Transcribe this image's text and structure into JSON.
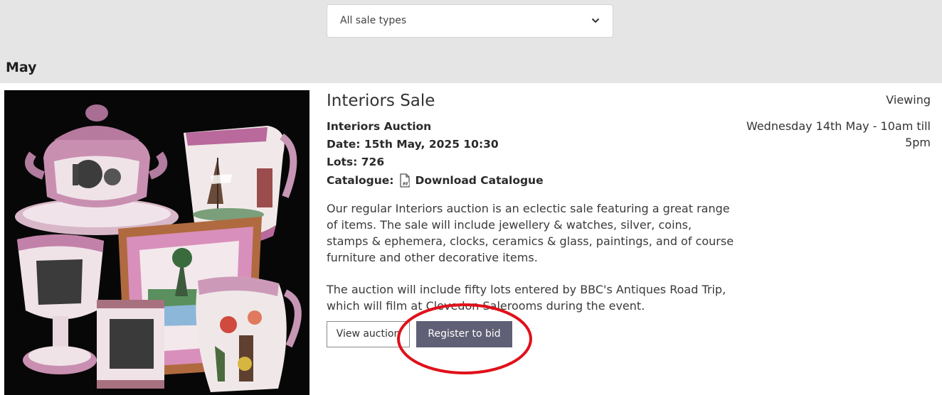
{
  "filter": {
    "sale_type_selected": "All sale types",
    "icon": "chevron-down-icon"
  },
  "month": "May",
  "sale": {
    "title": "Interiors Sale",
    "auction_name": "Interiors Auction",
    "date": "Date: 15th May, 2025 10:30",
    "lots": "Lots: 726",
    "catalogue_label": "Catalogue:",
    "catalogue_icon": "pdf-file-icon",
    "download_label": "Download Catalogue",
    "description_1": "Our regular Interiors auction is an eclectic sale featuring a great range of items. The sale will include jewellery & watches, silver, coins, stamps & ephemera, clocks, ceramics & glass, paintings, and of course furniture and other decorative items.",
    "description_2": "The auction will include fifty lots entered by BBC's Antiques Road Trip, which will film at Clevedon Salerooms during the event.",
    "view_auction_label": "View auction",
    "register_label": "Register to bid",
    "image_subject": "lustreware pottery photo"
  },
  "viewing": {
    "label": "Viewing",
    "time": "Wednesday 14th May - 10am till 5pm"
  },
  "colors": {
    "band": "#e5e5e5",
    "register_button": "#5f5f75",
    "annotation_circle": "#e0101a"
  }
}
